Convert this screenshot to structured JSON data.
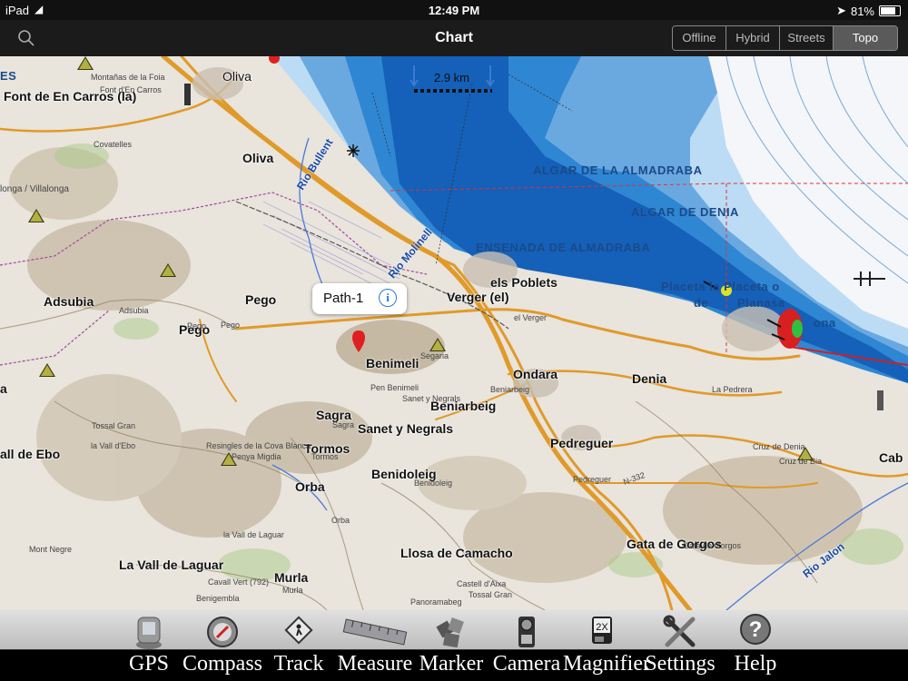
{
  "status": {
    "device": "iPad",
    "time": "12:49 PM",
    "battery": "81%"
  },
  "nav": {
    "title": "Chart",
    "map_modes": [
      "Offline",
      "Hybrid",
      "Streets",
      "Topo"
    ],
    "active_mode": "Topo"
  },
  "map": {
    "scale_label": "2.9 km",
    "callout_title": "Path-1",
    "places": {
      "oliva_top": "Oliva",
      "font": "Font de En Carros (la)",
      "oliva": "Oliva",
      "adsubia": "Adsubia",
      "pego_big": "Pego",
      "pego": "Pego",
      "benimeli": "Benimeli",
      "verger": "Verger (el)",
      "poblets": "els Poblets",
      "ondara": "Ondara",
      "beniarbeig": "Beniarbeig",
      "sagra": "Sagra",
      "sanet": "Sanet y Negrals",
      "tormos": "Tormos",
      "benidoleig": "Benidoleig",
      "orba": "Orba",
      "pedreguer": "Pedreguer",
      "denia": "Denia",
      "gata": "Gata de Gorgos",
      "llosa": "Llosa de Camacho",
      "laguar": "La Vall de Laguar",
      "murla": "Murla",
      "ebo": "all de Ebo",
      "cab": "Cab",
      "placeta": "Placeta la Placeta o",
      "planasa": "Planasa",
      "de": "de",
      "ona": "ona",
      "a_left": "a",
      "es": "ES"
    },
    "small_labels": {
      "montanas": "Montañas de la Foia",
      "carros": "Font d'En Carros",
      "covatelles": "Covatelles",
      "vallonga": "longa / Villalonga",
      "adsubia_s": "Adsubia",
      "pego_s": "Pego",
      "verger_s": "el Verger",
      "beniarbeig_s": "Beniarbeig",
      "sanet_s": "Sanet y Negrals",
      "pen": "Pen Benimeli",
      "segaria": "Segaria",
      "sagra_s": "Sagra",
      "tossal": "Tossal Gran",
      "vall_ebo": "la Vall d'Ebo",
      "resingles": "Resingles de la Cova Blanca",
      "migdia": "Penya Migdia",
      "tormos_s": "Tormos",
      "benidoleig_s": "Benidoleig",
      "orba_s": "Orba",
      "pedreguer_s": "Pedreguer",
      "pedrera": "La Pedrera",
      "creu": "Cruz de Denia",
      "cruz_m": "Cruz de Bia",
      "n332": "N-332",
      "monte_negre": "Mont Negre",
      "vall_laguar": "la Vall de Laguar",
      "cavall": "Cavall Vert (792)",
      "benigembla": "Benigembla",
      "castell": "Castell d'Aixa",
      "panorama": "Panoramabeg",
      "tossal_s": "Tossal Gran",
      "murla_s": "Murla",
      "gata_s": "Gata de Gorgos",
      "pego_w": "Pego"
    },
    "seas": [
      "ALGAR DE LA ALMADRABA",
      "ALGAR DE DENIA",
      "ENSENADA DE ALMADRABA"
    ],
    "rivers": [
      "Rio Bullent",
      "Rio Molinell",
      "Rio Jalon"
    ]
  },
  "toolbar": [
    {
      "label": "GPS",
      "icon": "gps-icon"
    },
    {
      "label": "Compass",
      "icon": "compass-icon"
    },
    {
      "label": "Track",
      "icon": "track-icon"
    },
    {
      "label": "Measure",
      "icon": "measure-icon"
    },
    {
      "label": "Marker",
      "icon": "marker-icon"
    },
    {
      "label": "Camera",
      "icon": "camera-icon"
    },
    {
      "label": "Magnifier",
      "icon": "magnifier-icon"
    },
    {
      "label": "Settings",
      "icon": "settings-icon"
    },
    {
      "label": "Help",
      "icon": "help-icon"
    }
  ],
  "magnifier_badge": "2X",
  "help_glyph": "?",
  "colors": {
    "sea_deep": "#1560b8",
    "sea_mid": "#2f86d3",
    "sea_light": "#bcdcf5",
    "road": "#e09a2a"
  }
}
